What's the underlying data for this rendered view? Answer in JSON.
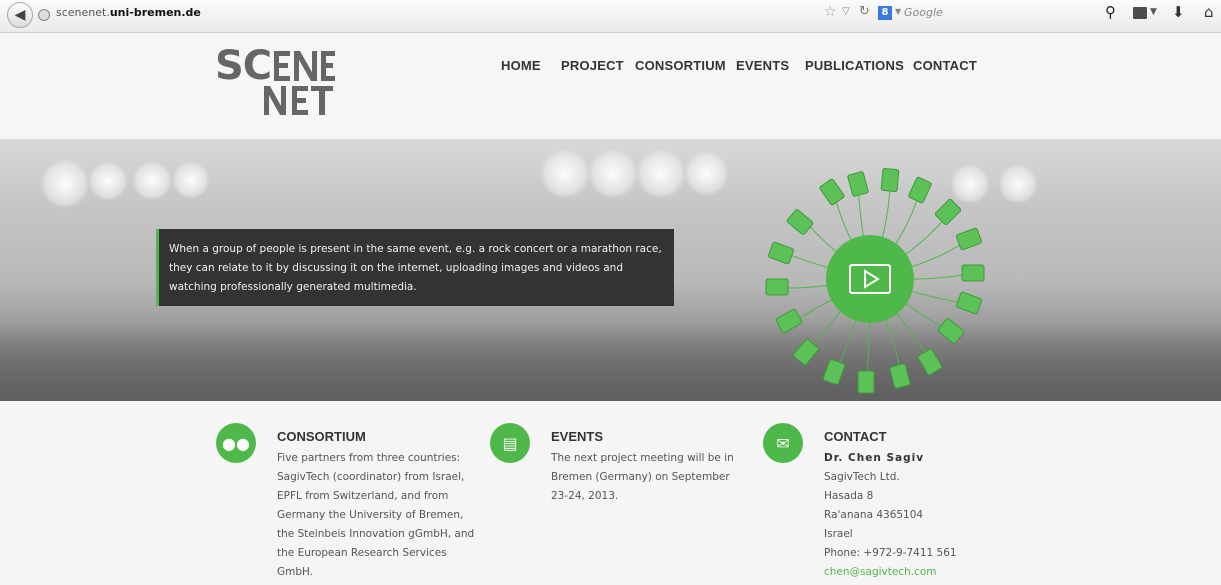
{
  "browser": {
    "url_prefix": "scenenet.",
    "url_domain": "uni-bremen.de",
    "search_engine": "Google",
    "search_logo_letter": "8"
  },
  "header": {
    "logo_top": "SC",
    "logo_mark": "SCENE NET"
  },
  "nav": [
    {
      "label": "HOME"
    },
    {
      "label": "PROJECT"
    },
    {
      "label": "CONSORTIUM"
    },
    {
      "label": "EVENTS"
    },
    {
      "label": "PUBLICATIONS"
    },
    {
      "label": "CONTACT"
    }
  ],
  "hero": {
    "caption": "When a group of people is present in the same event, e.g. a rock concert or a marathon race, they can relate to it by discussing it on the internet, uploading images and videos and watching professionally generated multimedia."
  },
  "sections": {
    "consortium": {
      "title": "CONSORTIUM",
      "lines": [
        "Five partners from three countries:",
        "SagivTech (coordinator) from Israel,",
        "EPFL from Switzerland, and from",
        "Germany the University of Bremen,",
        "the Steinbeis Innovation gGmbH, and",
        "the European Research Services",
        "GmbH."
      ]
    },
    "events": {
      "title": "EVENTS",
      "lines": [
        "The next project meeting will be in",
        "Bremen (Germany) on September",
        "23-24, 2013."
      ]
    },
    "contact": {
      "title": "CONTACT",
      "name": "Dr. Chen  Sagiv",
      "lines": [
        "SagivTech Ltd.",
        "Hasada 8",
        "Ra'anana 4365104",
        "Israel",
        "Phone: +972-9-7411 561"
      ],
      "email": "chen@sagivtech.com"
    }
  },
  "colors": {
    "accent": "#4fb84a"
  }
}
